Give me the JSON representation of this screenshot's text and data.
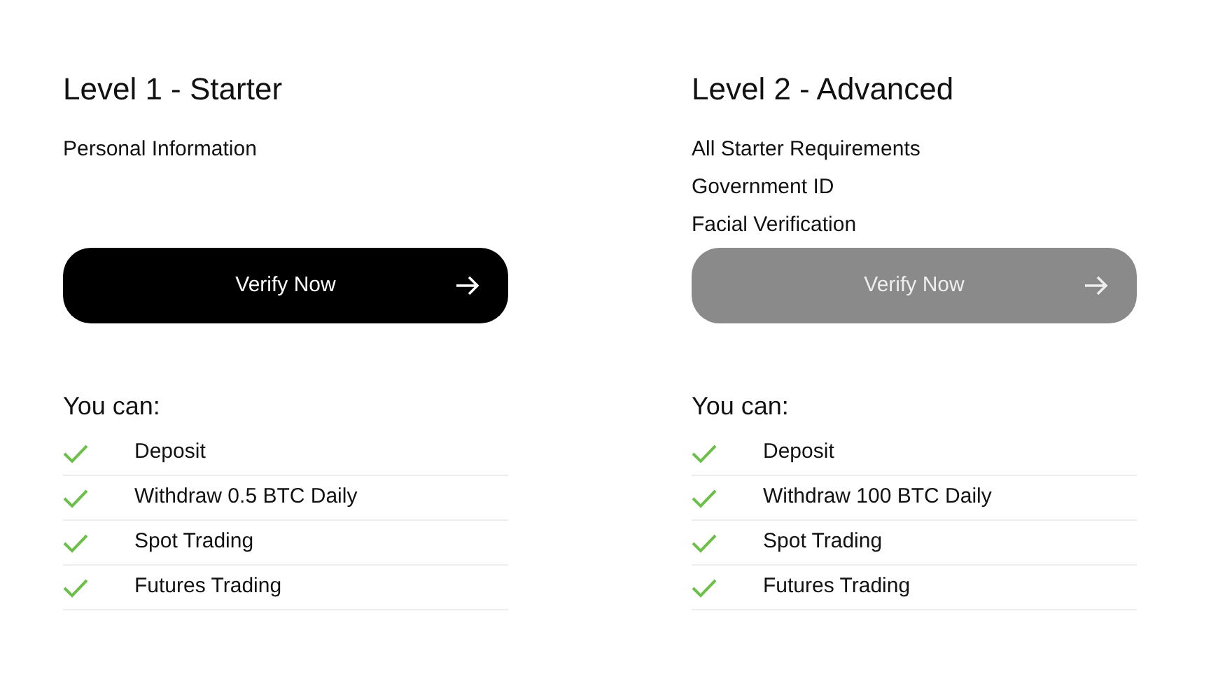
{
  "levels": [
    {
      "title": "Level 1 - Starter",
      "requirements": [
        "Personal Information"
      ],
      "button": {
        "label": "Verify Now",
        "disabled": false
      },
      "abilities_heading": "You can:",
      "abilities": [
        "Deposit",
        "Withdraw 0.5 BTC Daily",
        "Spot Trading",
        "Futures Trading"
      ]
    },
    {
      "title": "Level 2 - Advanced",
      "requirements": [
        "All Starter Requirements",
        "Government ID",
        "Facial Verification"
      ],
      "button": {
        "label": "Verify Now",
        "disabled": true
      },
      "abilities_heading": "You can:",
      "abilities": [
        "Deposit",
        "Withdraw 100 BTC Daily",
        "Spot Trading",
        "Futures Trading"
      ]
    }
  ]
}
